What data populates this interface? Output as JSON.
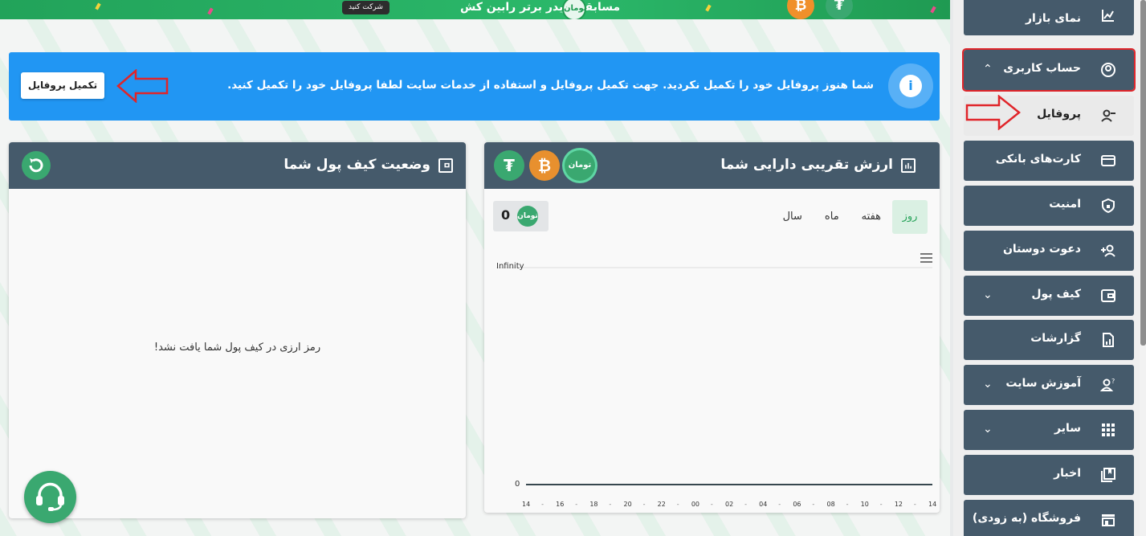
{
  "banner": {
    "text": "مسابقه تریدر برتر رابین کش",
    "button": "شرکت کنید",
    "coin_b": "₿",
    "coin_t": "₮",
    "toman": "تومان"
  },
  "alert": {
    "message": "شما هنوز پروفایل خود را تکمیل نکردید. جهت تکمیل پروفایل و استفاده از خدمات سایت لطفا پروفایل خود را تکمیل کنید.",
    "button": "تکمیل پروفایل",
    "info": "i"
  },
  "assets_card": {
    "title": "ارزش تقریبی دارایی شما",
    "coins": {
      "tether": "₮",
      "bitcoin": "₿",
      "toman": "تومان"
    },
    "tabs": [
      "روز",
      "هفته",
      "ماه",
      "سال"
    ],
    "balance": "0"
  },
  "wallet_card": {
    "title": "وضعیت کیف پول شما",
    "empty_message": "رمز ارزی در کیف پول شما یافت نشد!"
  },
  "chart_data": {
    "type": "line",
    "x": [
      "14",
      "16",
      "18",
      "20",
      "22",
      "00",
      "02",
      "04",
      "06",
      "08",
      "10",
      "12",
      "14"
    ],
    "series": [
      {
        "values": [
          0,
          0,
          0,
          0,
          0,
          0,
          0,
          0,
          0,
          0,
          0,
          0,
          0
        ]
      }
    ],
    "y_top_label": "Infinity",
    "y_bottom_label": "0",
    "tick_separator": "-",
    "color": "#37474f"
  },
  "sidebar": {
    "items": [
      {
        "label": "نمای بازار",
        "icon": "chart-icon"
      },
      {
        "label": "حساب کاربری",
        "icon": "user-circle-icon",
        "chevron": "⌃"
      },
      {
        "label": "پروفایل",
        "icon": "user-icon"
      },
      {
        "label": "کارت‌های بانکی",
        "icon": "card-icon"
      },
      {
        "label": "امنیت",
        "icon": "shield-icon"
      },
      {
        "label": "دعوت دوستان",
        "icon": "user-add-icon"
      },
      {
        "label": "کیف پول",
        "icon": "wallet-icon",
        "chevron": "⌄"
      },
      {
        "label": "گزارشات",
        "icon": "report-icon"
      },
      {
        "label": "آموزش سایت",
        "icon": "help-user-icon",
        "chevron": "⌄"
      },
      {
        "label": "سایر",
        "icon": "grid-icon",
        "chevron": "⌄"
      },
      {
        "label": "اخبار",
        "icon": "news-icon"
      },
      {
        "label": "فروشگاه (به زودی)",
        "icon": "store-icon"
      }
    ]
  },
  "colors": {
    "accent": "#2196f3",
    "green": "#3aa870",
    "header": "#455a6b",
    "highlight": "#e0252a"
  }
}
